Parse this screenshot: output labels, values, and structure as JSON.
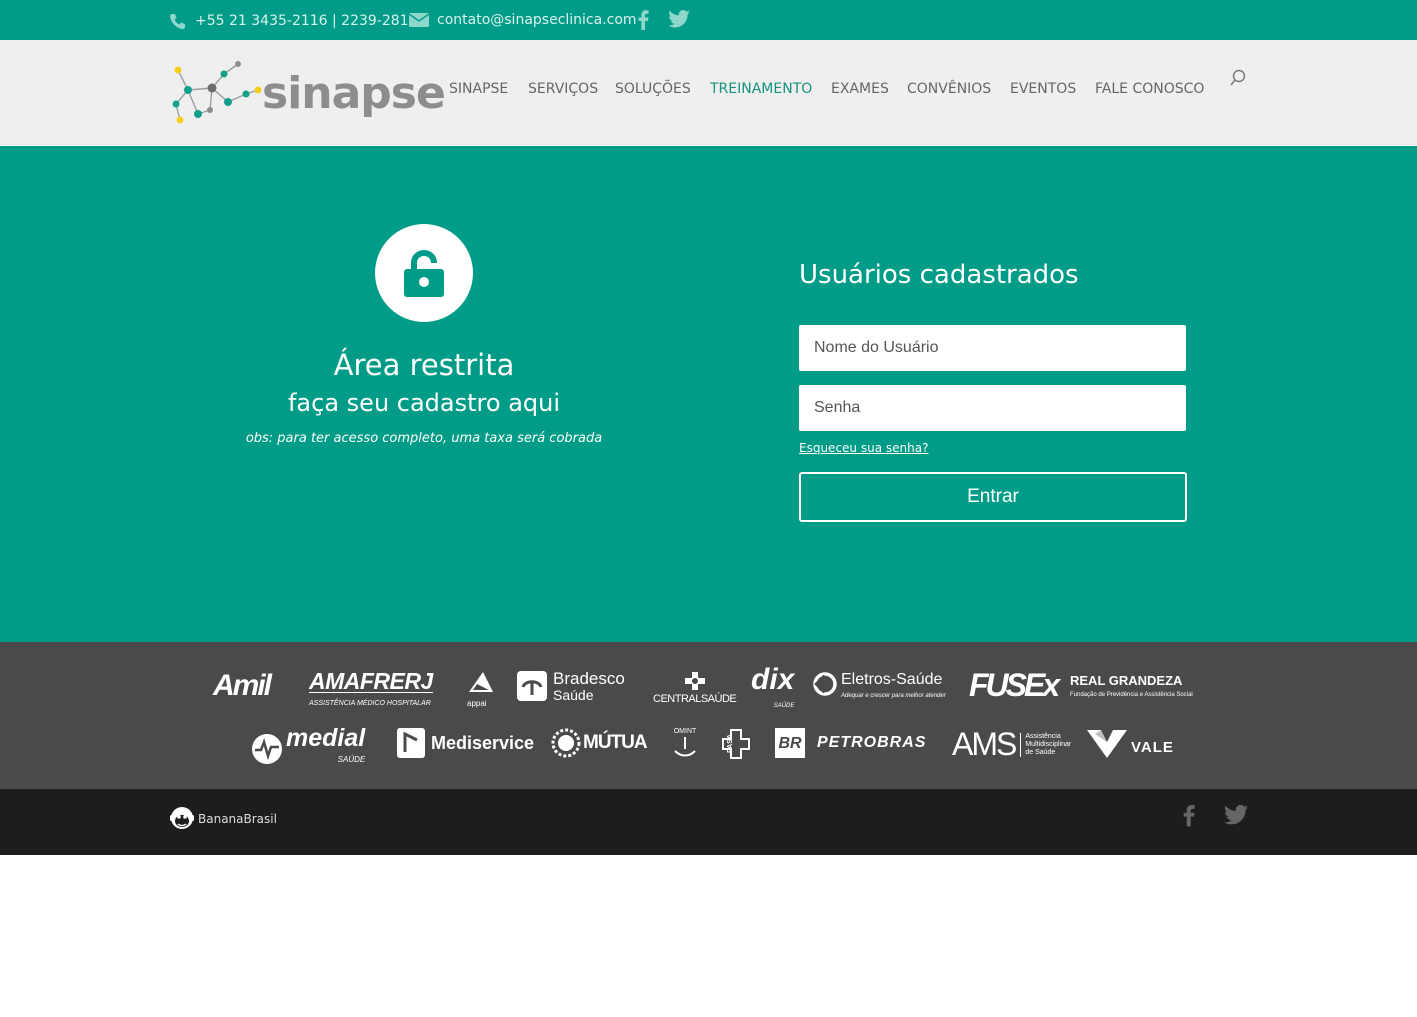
{
  "topbar": {
    "phone": "+55 21 3435-2116 | 2239-2813",
    "email": "contato@sinapseclinica.com",
    "icons": [
      "phone-icon",
      "mail-icon",
      "facebook-icon",
      "twitter-icon"
    ]
  },
  "header": {
    "logo_text": "sinapse",
    "nav": [
      "SINAPSE",
      "SERVIÇOS",
      "SOLUÇÕES",
      "TREINAMENTO",
      "EXAMES",
      "CONVÊNIOS",
      "EVENTOS",
      "FALE CONOSCO"
    ],
    "active_nav": "TREINAMENTO",
    "search_icon": "search-icon"
  },
  "restricted": {
    "icon": "unlock-icon",
    "title": "Área restrita",
    "subtitle": "faça seu cadastro aqui",
    "note": "obs: para ter acesso completo, uma taxa será cobrada"
  },
  "login": {
    "title": "Usuários cadastrados",
    "username_placeholder": "Nome do Usuário",
    "password_placeholder": "Senha",
    "forgot": "Esqueceu sua senha?",
    "submit": "Entrar"
  },
  "partners": {
    "amil": "Amil",
    "amafrerj": "AMAFRERJ",
    "amafrerj_sub": "ASSISTÊNCIA MÉDICO HOSPITALAR",
    "appai": "appai",
    "bradesco": "Bradesco",
    "bradesco_sub": "Saúde",
    "central": "CENTRALSAÚDE",
    "dix": "dix",
    "dix_sub": "SAÚDE",
    "eletros": "Eletros-Saúde",
    "eletros_sub": "Adequar e crescer para melhor atender",
    "fusex": "FUSEx",
    "real": "REAL GRANDEZA",
    "real_sub": "Fundação de Previdência e Assistência Social",
    "medial": "medial",
    "medial_sub": "SAÚDE",
    "mediservice": "Mediservice",
    "mutua": "MÚTUA",
    "omint": "OMINT",
    "pasa": "PASA",
    "petrobras": "PETROBRAS",
    "br": "BR",
    "ams": "AMS",
    "ams_sub": "Assistência Multidisciplinar de Saúde",
    "vale": "VALE"
  },
  "footer": {
    "credit": "BananaBrasil",
    "icons": [
      "facebook-icon",
      "twitter-icon"
    ]
  },
  "colors": {
    "brand": "#009c87",
    "header_bg": "#efefef",
    "partners_bg": "#4a4a4a",
    "footer_bg": "#1d1d1d"
  }
}
